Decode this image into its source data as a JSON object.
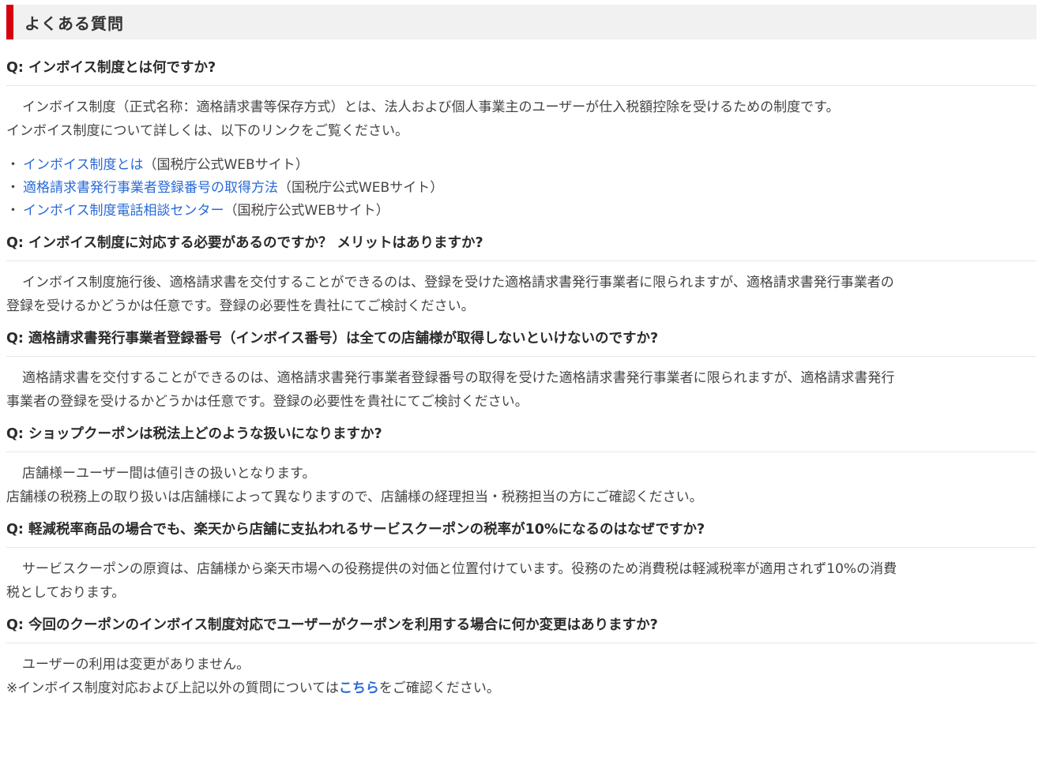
{
  "header": {
    "title": "よくある質問"
  },
  "faq": {
    "q1": {
      "question": "Q: インボイス制度とは何ですか?",
      "answer_line1": "インボイス制度（正式名称：適格請求書等保存方式）とは、法人および個人事業主のユーザーが仕入税額控除を受けるための制度です。",
      "answer_line2": "インボイス制度について詳しくは、以下のリンクをご覧ください。",
      "links": [
        {
          "bullet": "・",
          "text": "インボイス制度とは",
          "suffix": "（国税庁公式WEBサイト）"
        },
        {
          "bullet": "・",
          "text": "適格請求書発行事業者登録番号の取得方法",
          "suffix": "（国税庁公式WEBサイト）"
        },
        {
          "bullet": "・",
          "text": "インボイス制度電話相談センター",
          "suffix": "（国税庁公式WEBサイト）"
        }
      ]
    },
    "q2": {
      "question": "Q: インボイス制度に対応する必要があるのですか？ メリットはありますか?",
      "answer_line1": "インボイス制度施行後、適格請求書を交付することができるのは、登録を受けた適格請求書発行事業者に限られますが、適格請求書発行事業者の",
      "answer_line2": "登録を受けるかどうかは任意です。登録の必要性を貴社にてご検討ください。"
    },
    "q3": {
      "question": "Q: 適格請求書発行事業者登録番号（インボイス番号）は全ての店舗様が取得しないといけないのですか?",
      "answer_line1": "適格請求書を交付することができるのは、適格請求書発行事業者登録番号の取得を受けた適格請求書発行事業者に限られますが、適格請求書発行",
      "answer_line2": "事業者の登録を受けるかどうかは任意です。登録の必要性を貴社にてご検討ください。"
    },
    "q4": {
      "question": "Q: ショップクーポンは税法上どのような扱いになりますか?",
      "answer_line1": "店舗様ーユーザー間は値引きの扱いとなります。",
      "answer_line2": "店舗様の税務上の取り扱いは店舗様によって異なりますので、店舗様の経理担当・税務担当の方にご確認ください。"
    },
    "q5": {
      "question": "Q: 軽減税率商品の場合でも、楽天から店舗に支払われるサービスクーポンの税率が10%になるのはなぜですか?",
      "answer_line1": "サービスクーポンの原資は、店舗様から楽天市場への役務提供の対価と位置付けています。役務のため消費税は軽減税率が適用されず10%の消費",
      "answer_line2": "税としております。"
    },
    "q6": {
      "question": "Q: 今回のクーポンのインボイス制度対応でユーザーがクーポンを利用する場合に何か変更はありますか?",
      "answer_line1": "ユーザーの利用は変更がありません。",
      "answer_line2_prefix": "※インボイス制度対応および上記以外の質問については",
      "answer_line2_link": "こちら",
      "answer_line2_suffix": "をご確認ください。"
    }
  },
  "colors": {
    "accent": "#d7000f",
    "link": "#2a6ad6",
    "header_bg": "#f1f1f1"
  }
}
